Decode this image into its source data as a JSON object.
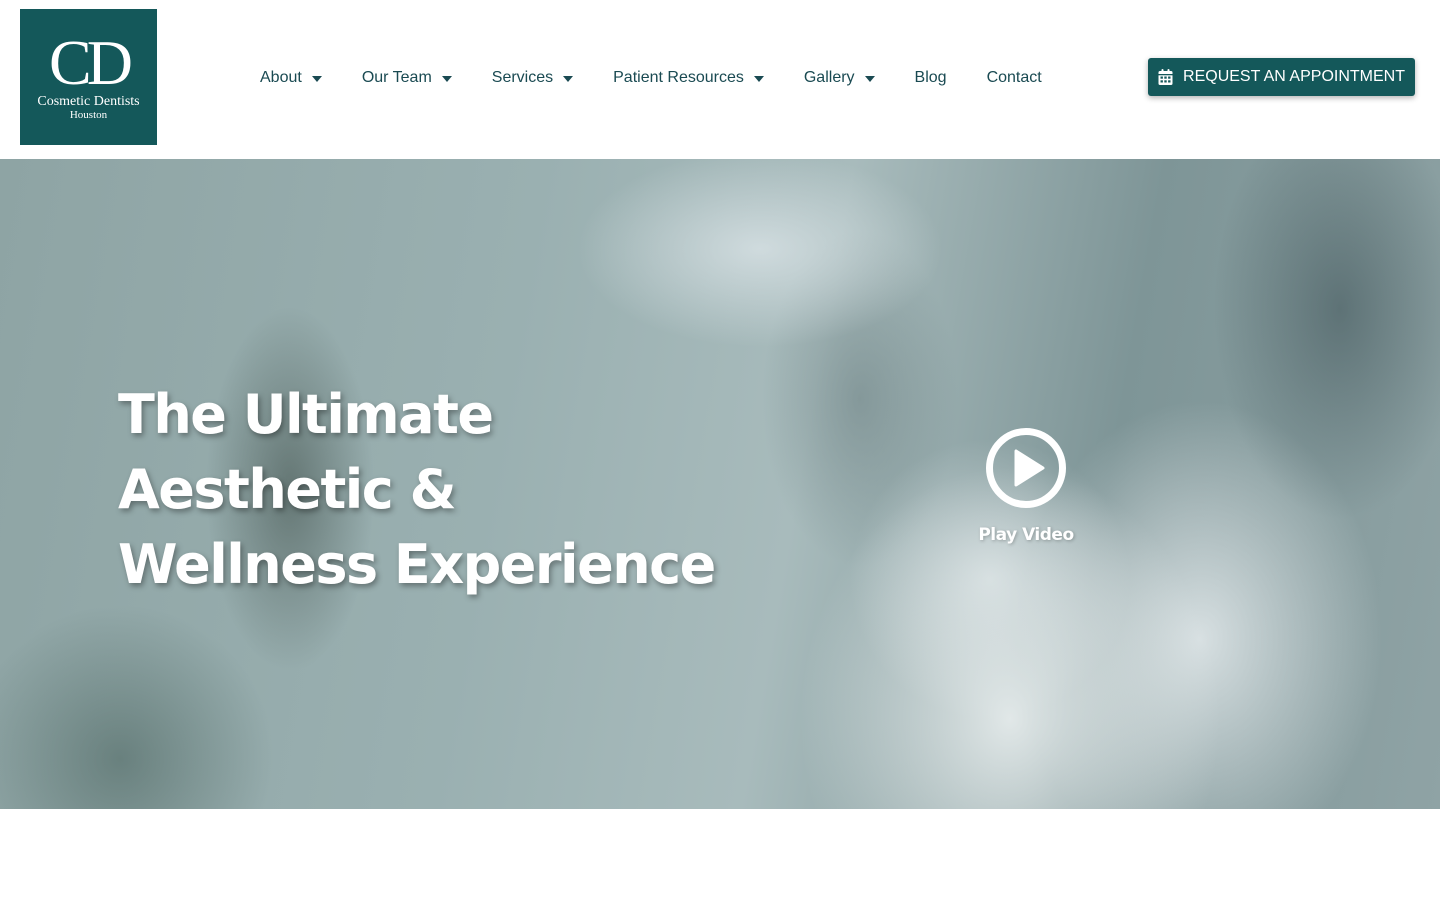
{
  "logo": {
    "mark": "CD",
    "name": "Cosmetic Dentists",
    "city": "Houston"
  },
  "nav": {
    "items": [
      {
        "label": "About",
        "has_dropdown": true
      },
      {
        "label": "Our Team",
        "has_dropdown": true
      },
      {
        "label": "Services",
        "has_dropdown": true
      },
      {
        "label": "Patient Resources",
        "has_dropdown": true
      },
      {
        "label": "Gallery",
        "has_dropdown": true
      },
      {
        "label": "Blog",
        "has_dropdown": false
      },
      {
        "label": "Contact",
        "has_dropdown": false
      }
    ]
  },
  "cta": {
    "label": "REQUEST AN APPOINTMENT",
    "icon": "calendar-icon"
  },
  "hero": {
    "title_lines": [
      "The Ultimate",
      "Aesthetic &",
      "Wellness Experience"
    ],
    "play_label": "Play Video",
    "play_icon": "play-circle-icon"
  },
  "colors": {
    "brand": "#14585a",
    "nav_text": "#1a4a52",
    "hero_text": "#ffffff"
  }
}
